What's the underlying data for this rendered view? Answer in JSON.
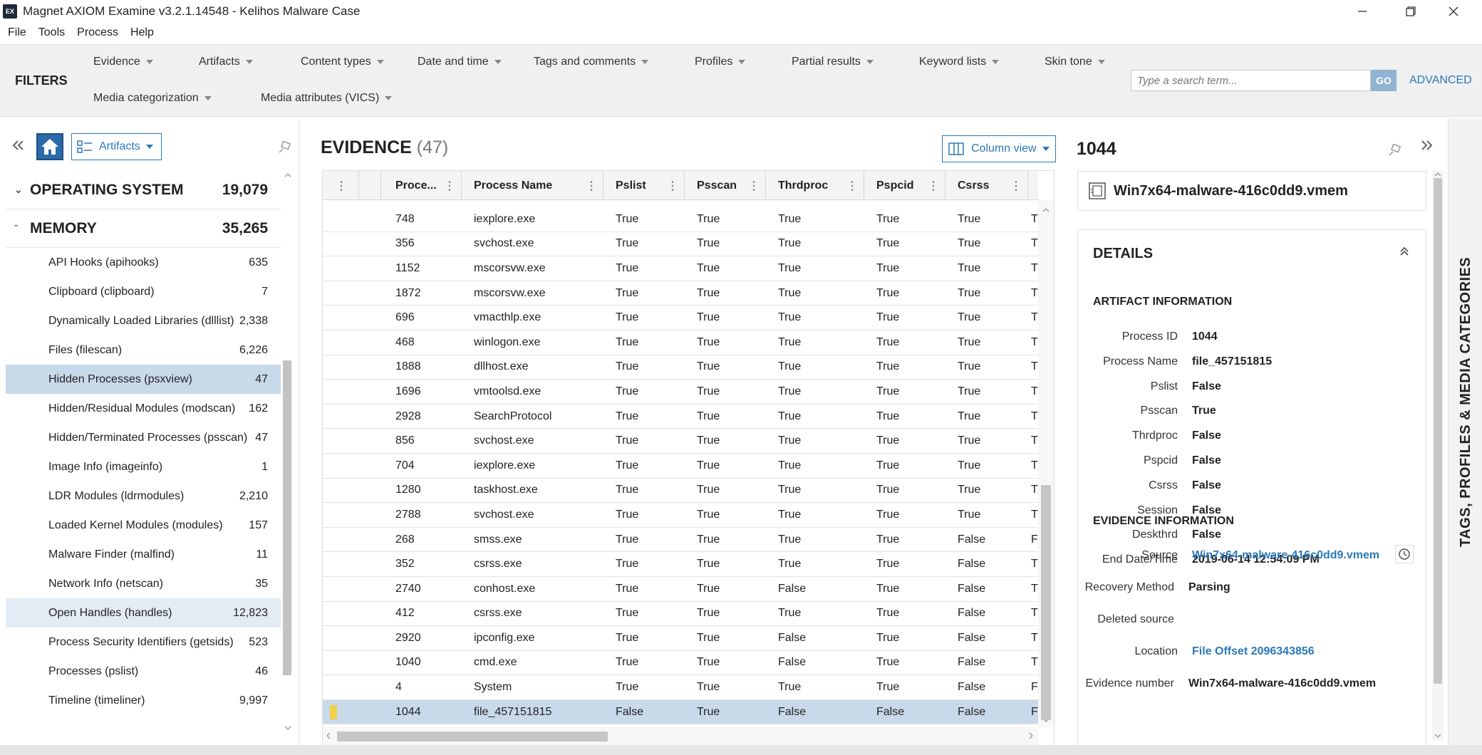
{
  "window": {
    "title": "Magnet AXIOM Examine v3.2.1.14548 - Kelihos Malware Case",
    "app_icon_text": "EX"
  },
  "menu": [
    "File",
    "Tools",
    "Process",
    "Help"
  ],
  "filters": {
    "label": "FILTERS",
    "row1": [
      "Evidence",
      "Artifacts",
      "Content types",
      "Date and time",
      "Tags and comments",
      "Profiles",
      "Partial results",
      "Keyword lists",
      "Skin tone"
    ],
    "row2": [
      "Media categorization",
      "Media attributes (VICS)"
    ],
    "search_placeholder": "Type a search term...",
    "go_label": "GO",
    "advanced_label": "ADVANCED"
  },
  "left_pane": {
    "view_selector": "Artifacts",
    "categories": [
      {
        "name": "OPERATING SYSTEM",
        "count": "19,079",
        "expanded": false
      },
      {
        "name": "MEMORY",
        "count": "35,265",
        "expanded": true
      }
    ],
    "memory_items": [
      {
        "label": "API Hooks (apihooks)",
        "count": "635"
      },
      {
        "label": "Clipboard (clipboard)",
        "count": "7"
      },
      {
        "label": "Dynamically Loaded Libraries (dlllist)",
        "count": "2,338"
      },
      {
        "label": "Files (filescan)",
        "count": "6,226"
      },
      {
        "label": "Hidden Processes (psxview)",
        "count": "47",
        "selected": true
      },
      {
        "label": "Hidden/Residual Modules (modscan)",
        "count": "162"
      },
      {
        "label": "Hidden/Terminated Processes (psscan)",
        "count": "47"
      },
      {
        "label": "Image Info (imageinfo)",
        "count": "1"
      },
      {
        "label": "LDR Modules (ldrmodules)",
        "count": "2,210"
      },
      {
        "label": "Loaded Kernel Modules (modules)",
        "count": "157"
      },
      {
        "label": "Malware Finder (malfind)",
        "count": "11"
      },
      {
        "label": "Network Info (netscan)",
        "count": "35"
      },
      {
        "label": "Open Handles (handles)",
        "count": "12,823",
        "hovered": true
      },
      {
        "label": "Process Security Identifiers (getsids)",
        "count": "523"
      },
      {
        "label": "Processes (pslist)",
        "count": "46"
      },
      {
        "label": "Timeline (timeliner)",
        "count": "9,997"
      }
    ]
  },
  "evidence": {
    "title": "EVIDENCE",
    "count": "(47)",
    "view_mode": "Column view",
    "columns": [
      "Proce...",
      "Process Name",
      "Pslist",
      "Psscan",
      "Thrdproc",
      "Pspcid",
      "Csrss"
    ],
    "rows": [
      [
        "748",
        "iexplore.exe",
        "True",
        "True",
        "True",
        "True",
        "True",
        "T"
      ],
      [
        "356",
        "svchost.exe",
        "True",
        "True",
        "True",
        "True",
        "True",
        "T"
      ],
      [
        "1152",
        "mscorsvw.exe",
        "True",
        "True",
        "True",
        "True",
        "True",
        "T"
      ],
      [
        "1872",
        "mscorsvw.exe",
        "True",
        "True",
        "True",
        "True",
        "True",
        "T"
      ],
      [
        "696",
        "vmacthlp.exe",
        "True",
        "True",
        "True",
        "True",
        "True",
        "T"
      ],
      [
        "468",
        "winlogon.exe",
        "True",
        "True",
        "True",
        "True",
        "True",
        "T"
      ],
      [
        "1888",
        "dllhost.exe",
        "True",
        "True",
        "True",
        "True",
        "True",
        "T"
      ],
      [
        "1696",
        "vmtoolsd.exe",
        "True",
        "True",
        "True",
        "True",
        "True",
        "T"
      ],
      [
        "2928",
        "SearchProtocol",
        "True",
        "True",
        "True",
        "True",
        "True",
        "T"
      ],
      [
        "856",
        "svchost.exe",
        "True",
        "True",
        "True",
        "True",
        "True",
        "T"
      ],
      [
        "704",
        "iexplore.exe",
        "True",
        "True",
        "True",
        "True",
        "True",
        "T"
      ],
      [
        "1280",
        "taskhost.exe",
        "True",
        "True",
        "True",
        "True",
        "True",
        "T"
      ],
      [
        "2788",
        "svchost.exe",
        "True",
        "True",
        "True",
        "True",
        "True",
        "T"
      ],
      [
        "268",
        "smss.exe",
        "True",
        "True",
        "True",
        "True",
        "False",
        "F"
      ],
      [
        "352",
        "csrss.exe",
        "True",
        "True",
        "True",
        "True",
        "False",
        "T"
      ],
      [
        "2740",
        "conhost.exe",
        "True",
        "True",
        "False",
        "True",
        "False",
        "T"
      ],
      [
        "412",
        "csrss.exe",
        "True",
        "True",
        "True",
        "True",
        "False",
        "T"
      ],
      [
        "2920",
        "ipconfig.exe",
        "True",
        "True",
        "False",
        "True",
        "False",
        "T"
      ],
      [
        "1040",
        "cmd.exe",
        "True",
        "True",
        "False",
        "True",
        "False",
        "T"
      ],
      [
        "4",
        "System",
        "True",
        "True",
        "True",
        "True",
        "False",
        "F"
      ],
      [
        "1044",
        "file_457151815",
        "False",
        "True",
        "False",
        "False",
        "False",
        "F"
      ]
    ],
    "selected_row": 20
  },
  "details": {
    "header": "1044",
    "file": "Win7x64-malware-416c0dd9.vmem",
    "title": "DETAILS",
    "artifact_info_title": "ARTIFACT INFORMATION",
    "artifact_info": [
      {
        "label": "Process ID",
        "value": "1044"
      },
      {
        "label": "Process Name",
        "value": "file_457151815"
      },
      {
        "label": "Pslist",
        "value": "False"
      },
      {
        "label": "Psscan",
        "value": "True"
      },
      {
        "label": "Thrdproc",
        "value": "False"
      },
      {
        "label": "Pspcid",
        "value": "False"
      },
      {
        "label": "Csrss",
        "value": "False"
      },
      {
        "label": "Session",
        "value": "False"
      },
      {
        "label": "Deskthrd",
        "value": "False"
      },
      {
        "label": "End Date/Time",
        "value": "2019-06-14 12:54:09 PM"
      }
    ],
    "evidence_info_title": "EVIDENCE INFORMATION",
    "evidence_info": [
      {
        "label": "Source",
        "value": "Win7x64-malware-416c0dd9.vmem",
        "link": true
      },
      {
        "label": "Recovery Method",
        "value": "Parsing"
      },
      {
        "label": "Deleted source",
        "value": ""
      },
      {
        "label": "Location",
        "value": "File Offset 2096343856",
        "link": true
      },
      {
        "label": "Evidence number",
        "value": "Win7x64-malware-416c0dd9.vmem"
      }
    ]
  },
  "side_tab": "TAGS, PROFILES & MEDIA CATEGORIES",
  "colors": {
    "accent": "#2b79b8",
    "selection": "#c8d9ea",
    "home": "#2b6aa8"
  }
}
